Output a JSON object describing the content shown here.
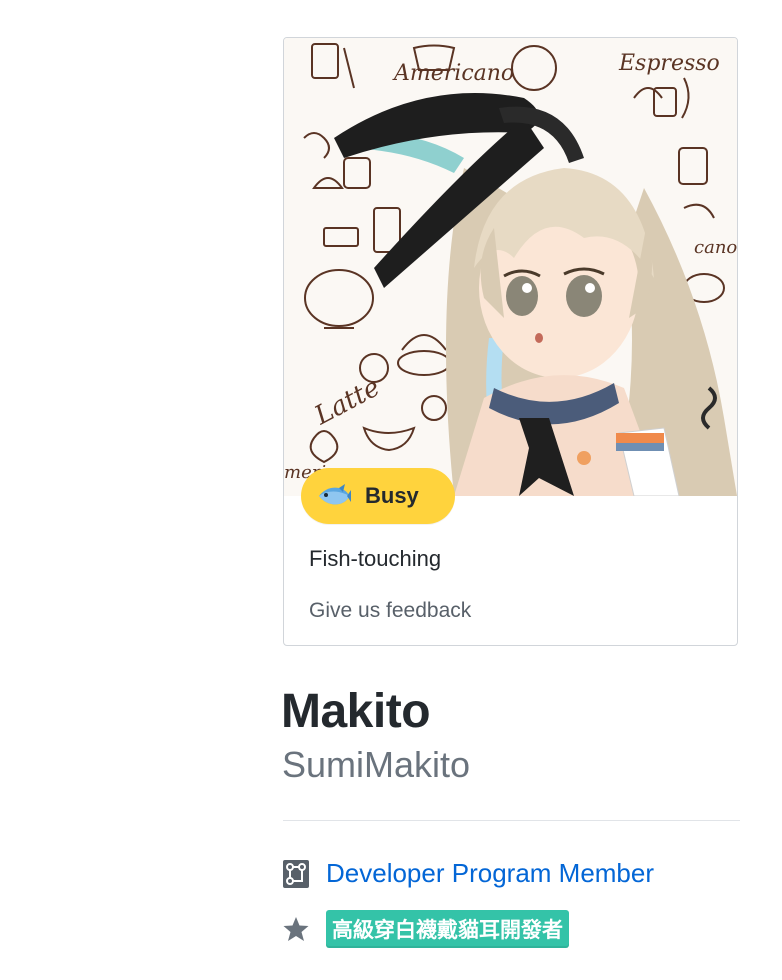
{
  "profile": {
    "name": "Makito",
    "username": "SumiMakito",
    "status": {
      "emoji": "fish-icon",
      "label": "Busy",
      "message": "Fish-touching",
      "feedback_link": "Give us feedback",
      "pill_color": "#ffd33d"
    },
    "avatar": {
      "background_words": [
        "Americano",
        "Espresso",
        "Latte",
        "Americano",
        "cano"
      ]
    },
    "badges": {
      "developer_program": "Developer Program Member",
      "custom_tag": "高級穿白襪戴貓耳開發者",
      "custom_tag_color": "#34c3a8"
    }
  },
  "colors": {
    "link": "#0366d6",
    "muted": "#6a737d",
    "text": "#24292e"
  }
}
